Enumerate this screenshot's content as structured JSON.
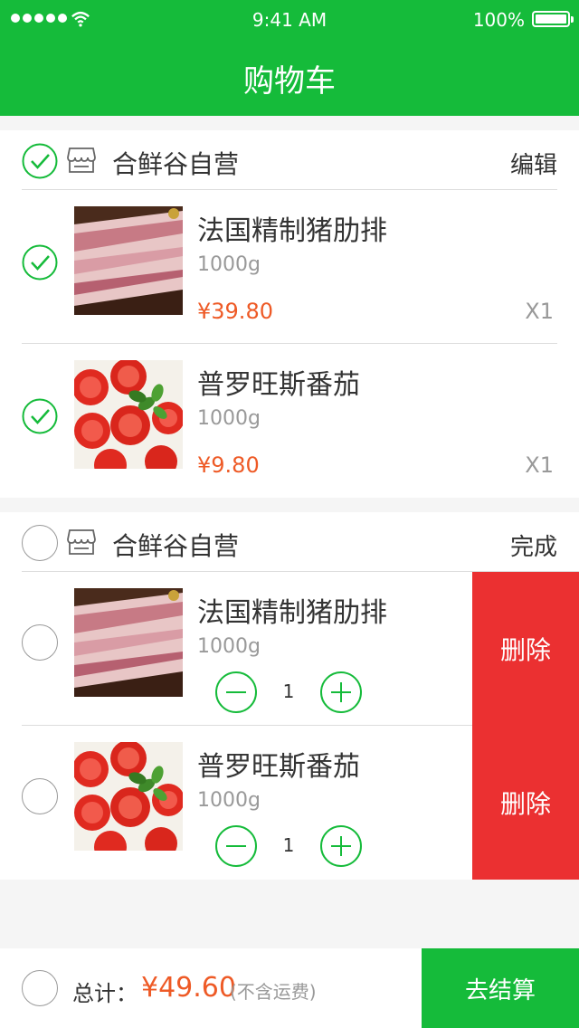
{
  "status_bar": {
    "time": "9:41 AM",
    "battery": "100%"
  },
  "header": {
    "title": "购物车"
  },
  "colors": {
    "brand_green": "#15bb3a",
    "price_orange": "#ee5a26",
    "delete_red": "#eb3031"
  },
  "shops": [
    {
      "name": "合鲜谷自营",
      "action": "编辑",
      "items": [
        {
          "name": "法国精制猪肋排",
          "weight": "1000g",
          "price": "¥39.80",
          "qty": "X1"
        },
        {
          "name": "普罗旺斯番茄",
          "weight": "1000g",
          "price": "¥9.80",
          "qty": "X1"
        }
      ]
    },
    {
      "name": "合鲜谷自营",
      "action": "完成",
      "items": [
        {
          "name": "法国精制猪肋排",
          "weight": "1000g",
          "qty": "1",
          "delete": "删除"
        },
        {
          "name": "普罗旺斯番茄",
          "weight": "1000g",
          "qty": "1",
          "delete": "删除"
        }
      ]
    }
  ],
  "footer": {
    "total_label": "总计：",
    "total_amount": "¥49.60",
    "note": "(不含运费)",
    "checkout": "去结算"
  },
  "icons": [
    "signal-icon",
    "wifi-icon",
    "battery-icon",
    "store-icon",
    "check-circle-icon",
    "minus-icon",
    "plus-icon"
  ]
}
